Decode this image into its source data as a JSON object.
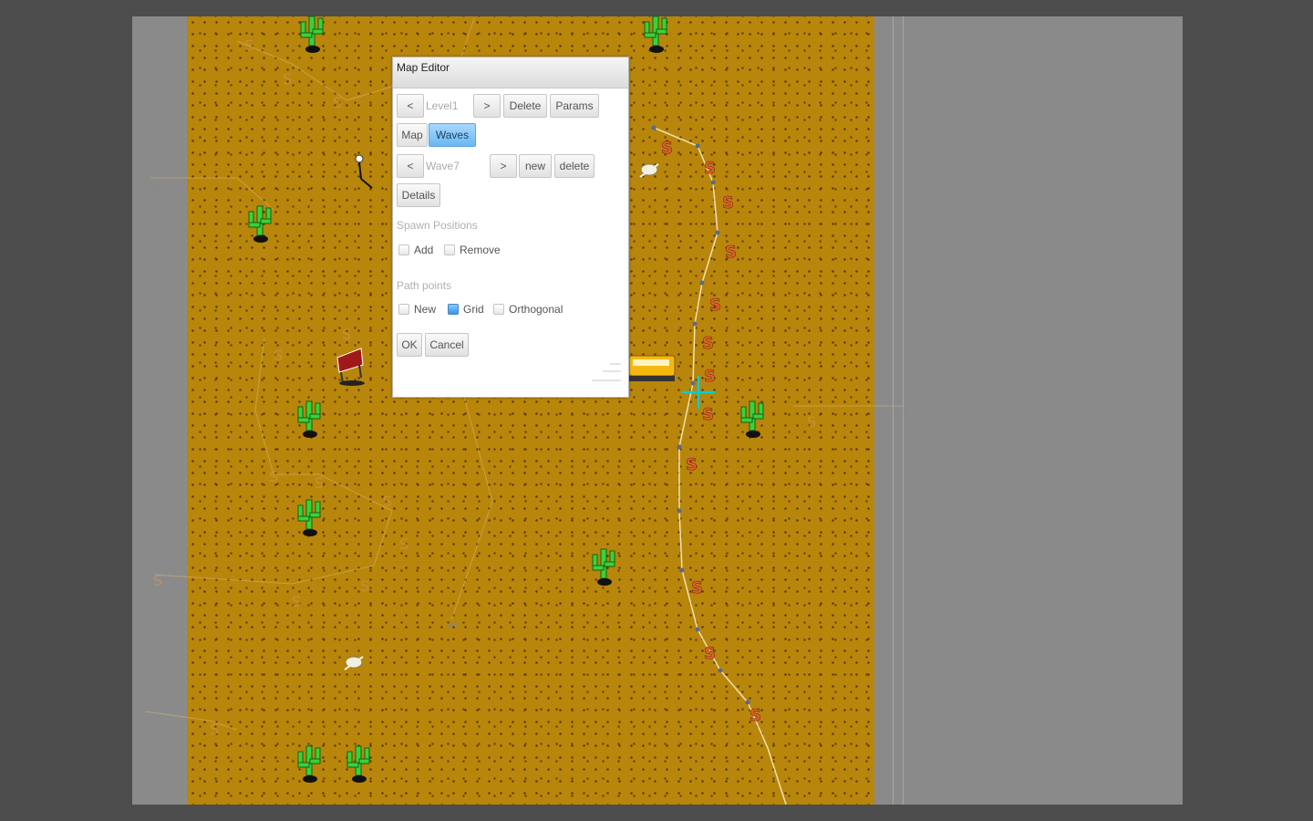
{
  "dialog": {
    "title": "Map Editor",
    "level": {
      "prev": "<",
      "value": "Level1",
      "next": ">",
      "delete": "Delete",
      "params": "Params"
    },
    "tabs": {
      "map": "Map",
      "waves": "Waves"
    },
    "wave": {
      "prev": "<",
      "value": "Wave7",
      "next": ">",
      "new": "new",
      "delete": "delete"
    },
    "details": "Details",
    "spawn_positions": {
      "label": "Spawn Positions",
      "add": "Add",
      "remove": "Remove"
    },
    "path_points": {
      "label": "Path points",
      "new": "New",
      "grid": "Grid",
      "grid_checked": true,
      "orthogonal": "Orthogonal"
    },
    "ok": "OK",
    "cancel": "Cancel"
  },
  "map": {
    "terrain": "desert",
    "colors": {
      "sand": "#b8860b",
      "path": "#e8d8a0",
      "cactus": "#33cc33",
      "spawn": "#e06030",
      "cursor": "#00cccc"
    },
    "objects": [
      "cactus-icon",
      "skull-icon",
      "sign-icon",
      "lamp-icon",
      "bus-icon",
      "spawn-marker-icon"
    ]
  }
}
